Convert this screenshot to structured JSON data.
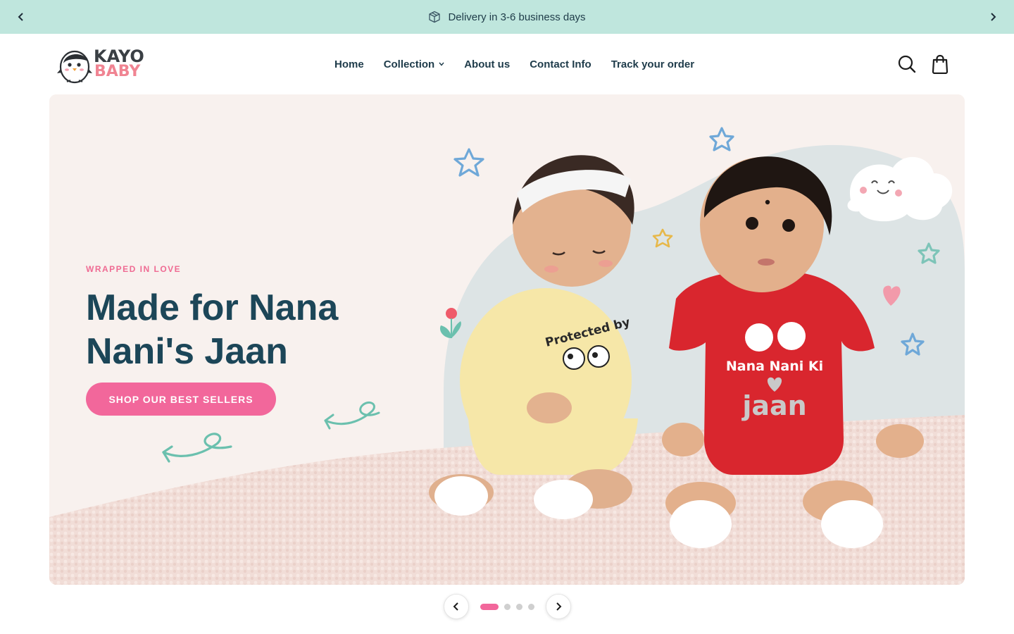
{
  "announcement": {
    "message": "Delivery in 3-6 business days",
    "icon": "package-icon",
    "prev_icon": "chevron-left-icon",
    "next_icon": "chevron-right-icon",
    "background": "#bfe6dd"
  },
  "header": {
    "logo": {
      "line1": "KAYO",
      "line2": "BABY",
      "icon": "penguin-logo"
    },
    "nav": [
      {
        "label": "Home"
      },
      {
        "label": "Collection",
        "has_dropdown": true
      },
      {
        "label": "About us"
      },
      {
        "label": "Contact Info"
      },
      {
        "label": "Track your order"
      }
    ],
    "icons": [
      "search-icon",
      "shopping-bag-icon"
    ]
  },
  "hero": {
    "eyebrow": "WRAPPED IN LOVE",
    "headline": "Made for Nana Nani's Jaan",
    "cta_label": "SHOP OUR BEST SELLERS",
    "image_shirt_text_left": "Protected by",
    "image_shirt_text_right_1": "Nana Nani Ki",
    "image_shirt_text_right_2": "jaan"
  },
  "slideshow": {
    "total_slides": 4,
    "active_slide": 1
  },
  "colors": {
    "accent_pink": "#f2679b",
    "heading_teal": "#1c4658",
    "nav_text": "#1e3b4a"
  }
}
